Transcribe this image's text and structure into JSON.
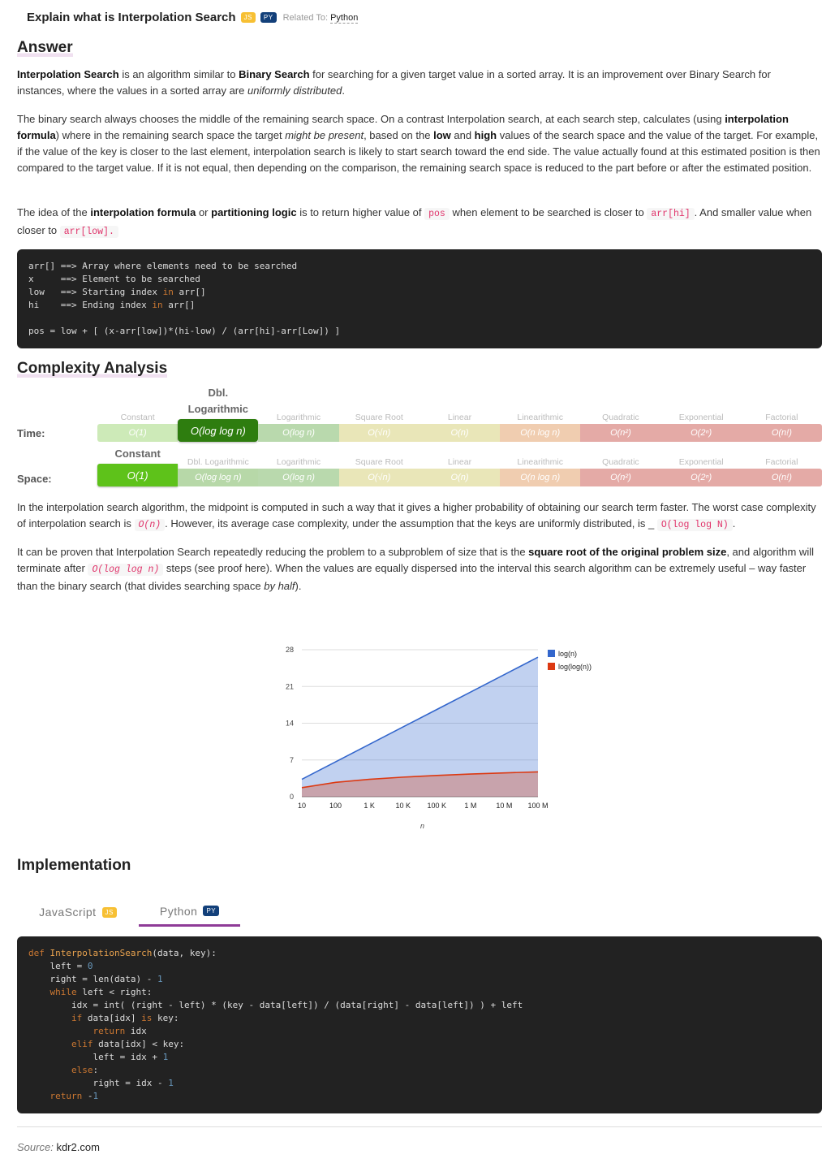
{
  "header": {
    "title": "Explain what is Interpolation Search",
    "badges": [
      "JS",
      "PY"
    ],
    "related_label": "Related To:",
    "related_value": "Python"
  },
  "answer": {
    "heading": "Answer",
    "paragraphs": [
      [
        [
          "b",
          "Interpolation Search"
        ],
        [
          "t",
          " is an algorithm similar to "
        ],
        [
          "b",
          "Binary Search"
        ],
        [
          "t",
          " for searching for a given target value in a sorted array. It is an improvement over Binary Search for instances, where the values in a sorted array are "
        ],
        [
          "i",
          "uniformly distributed"
        ],
        [
          "t",
          "."
        ]
      ],
      [
        [
          "t",
          "The binary search always chooses the middle of the remaining search space. On a contrast Interpolation search, at each search step, calculates (using "
        ],
        [
          "b",
          "interpolation formula"
        ],
        [
          "t",
          ") where in the remaining search space the target "
        ],
        [
          "i",
          "might be present"
        ],
        [
          "t",
          ", based on the "
        ],
        [
          "b",
          "low"
        ],
        [
          "t",
          " and "
        ],
        [
          "b",
          "high"
        ],
        [
          "t",
          " values of the search space and the value of the target. For example, if the value of the key is closer to the last element, interpolation search is likely to start search toward the end side. The value actually found at this estimated position is then compared to the target value. If it is not equal, then depending on the comparison, the remaining search space is reduced to the part before or after the estimated position."
        ]
      ],
      [
        [
          "t",
          "The idea of the "
        ],
        [
          "b",
          "interpolation formula"
        ],
        [
          "t",
          " or "
        ],
        [
          "b",
          "partitioning logic"
        ],
        [
          "t",
          " is to return higher value of "
        ],
        [
          "c",
          "pos"
        ],
        [
          "t",
          " when element to be searched is closer to "
        ],
        [
          "c",
          "arr[hi]"
        ],
        [
          "t",
          ". And smaller value when closer to "
        ],
        [
          "c",
          "arr[low]."
        ]
      ]
    ],
    "code": [
      [
        [
          "t",
          "arr[] ==> Array where elements need to be searched"
        ]
      ],
      [
        [
          "t",
          "x     ==> Element to be searched"
        ]
      ],
      [
        [
          "t",
          "low   ==> Starting index "
        ],
        [
          "kw",
          "in"
        ],
        [
          "t",
          " arr[]"
        ]
      ],
      [
        [
          "t",
          "hi    ==> Ending index "
        ],
        [
          "kw",
          "in"
        ],
        [
          "t",
          " arr[]"
        ]
      ],
      [
        [
          "t",
          ""
        ]
      ],
      [
        [
          "t",
          "pos = low + [ (x-arr[low])*(hi-low) / (arr[hi]-arr[Low]) ]"
        ]
      ]
    ]
  },
  "complexity": {
    "heading": "Complexity Analysis",
    "colors": [
      "#cdeab8",
      "#b7d8a8",
      "#b9d9ad",
      "#e9e6b8",
      "#e9e6b8",
      "#f0cdb0",
      "#e4aaa6",
      "#e4aaa6",
      "#e4aaa6"
    ],
    "rows": [
      {
        "label": "Time:",
        "active": 1,
        "active_color": "#2e7d0f",
        "names": [
          "Constant",
          "Dbl. Logarithmic",
          "Logarithmic",
          "Square Root",
          "Linear",
          "Linearithmic",
          "Quadratic",
          "Exponential",
          "Factorial"
        ],
        "values": [
          "O(1)",
          "O(log log n)",
          "O(log n)",
          "O(√n)",
          "O(n)",
          "O(n log n)",
          "O(n²)",
          "O(2ⁿ)",
          "O(n!)"
        ]
      },
      {
        "label": "Space:",
        "active": 0,
        "active_color": "#5ec21a",
        "names": [
          "Constant",
          "Dbl. Logarithmic",
          "Logarithmic",
          "Square Root",
          "Linear",
          "Linearithmic",
          "Quadratic",
          "Exponential",
          "Factorial"
        ],
        "values": [
          "O(1)",
          "O(log log n)",
          "O(log n)",
          "O(√n)",
          "O(n)",
          "O(n log n)",
          "O(n²)",
          "O(2ⁿ)",
          "O(n!)"
        ]
      }
    ],
    "paragraphs": [
      [
        [
          "t",
          "In the interpolation search algorithm, the midpoint is computed in such a way that it gives a higher probability of obtaining our search term faster. The worst case complexity of interpolation search is "
        ],
        [
          "ci",
          "O(n)"
        ],
        [
          "t",
          ". However, its average case complexity, under the assumption that the keys are uniformly distributed, is _ "
        ],
        [
          "c",
          "O(log log N)"
        ],
        [
          "t",
          "."
        ]
      ],
      [
        [
          "t",
          "It can be proven that Interpolation Search repeatedly reducing the problem to a subproblem of size that is the "
        ],
        [
          "b",
          "square root of the original problem size"
        ],
        [
          "t",
          ", and algorithm will terminate after "
        ],
        [
          "ci",
          "O(log log n)"
        ],
        [
          "t",
          " steps (see proof here). When the values are equally dispersed into the interval this search algorithm can be extremely useful – way faster than the binary search (that divides searching space "
        ],
        [
          "i",
          "by half"
        ],
        [
          "t",
          ")."
        ]
      ]
    ]
  },
  "chart_data": {
    "type": "area",
    "categories": [
      "10",
      "100",
      "1 K",
      "10 K",
      "100 K",
      "1 M",
      "10 M",
      "100 M"
    ],
    "xlabel": "n",
    "ylabel": "",
    "ylim": [
      0,
      28
    ],
    "yticks": [
      "0",
      "7",
      "14",
      "21",
      "28"
    ],
    "grid": true,
    "legend_position": "top-right",
    "series": [
      {
        "name": "log(n)",
        "color": "#3366cc",
        "values": [
          3.32,
          6.64,
          9.97,
          13.29,
          16.61,
          19.93,
          23.25,
          26.58
        ]
      },
      {
        "name": "log(log(n))",
        "color": "#dc3912",
        "values": [
          1.73,
          2.73,
          3.32,
          3.73,
          4.05,
          4.32,
          4.54,
          4.73
        ]
      }
    ]
  },
  "implementation": {
    "heading": "Implementation",
    "tabs": [
      {
        "label": "JavaScript",
        "badge": "JS"
      },
      {
        "label": "Python",
        "badge": "PY"
      }
    ],
    "code": [
      [
        [
          "kw",
          "def "
        ],
        [
          "fn",
          "InterpolationSearch"
        ],
        [
          "t",
          "(data, key):"
        ]
      ],
      [
        [
          "t",
          "    left = "
        ],
        [
          "num",
          "0"
        ]
      ],
      [
        [
          "t",
          "    right = len(data) - "
        ],
        [
          "num",
          "1"
        ]
      ],
      [
        [
          "kw",
          "    while"
        ],
        [
          "t",
          " left < right:"
        ]
      ],
      [
        [
          "t",
          "        idx = int( (right - left) * (key - data[left]) / (data[right] - data[left]) ) + left"
        ]
      ],
      [
        [
          "kw",
          "        if"
        ],
        [
          "t",
          " data[idx] "
        ],
        [
          "kw",
          "is"
        ],
        [
          "t",
          " key:"
        ]
      ],
      [
        [
          "kw",
          "            return"
        ],
        [
          "t",
          " idx"
        ]
      ],
      [
        [
          "kw",
          "        elif"
        ],
        [
          "t",
          " data[idx] < key:"
        ]
      ],
      [
        [
          "t",
          "            left = idx + "
        ],
        [
          "num",
          "1"
        ]
      ],
      [
        [
          "kw",
          "        else"
        ],
        [
          "t",
          ":"
        ]
      ],
      [
        [
          "t",
          "            right = idx - "
        ],
        [
          "num",
          "1"
        ]
      ],
      [
        [
          "kw",
          "    return"
        ],
        [
          "t",
          " -"
        ],
        [
          "num",
          "1"
        ]
      ]
    ]
  },
  "footer": {
    "source_label": "Source:",
    "source_value": "kdr2.com"
  }
}
